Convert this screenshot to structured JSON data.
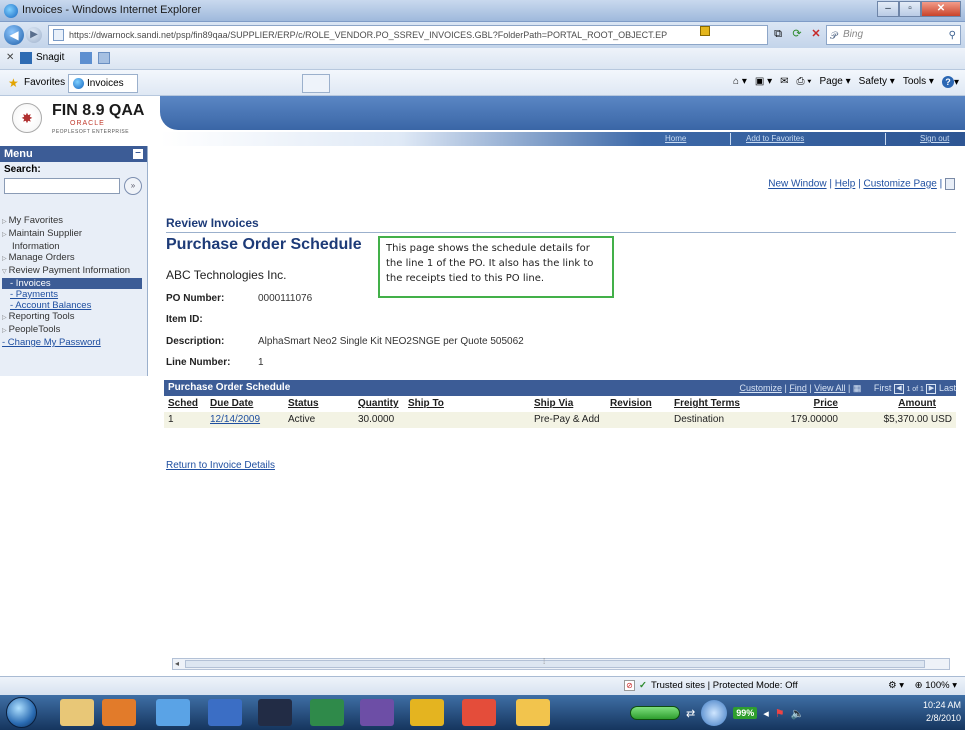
{
  "window": {
    "title": "Invoices - Windows Internet Explorer",
    "url": "https://dwarnock.sandi.net/psp/fin89qaa/SUPPLIER/ERP/c/ROLE_VENDOR.PO_SSREV_INVOICES.GBL?FolderPath=PORTAL_ROOT_OBJECT.EP",
    "url_host": "dwarnock.sandi.net",
    "search_placeholder": "Bing"
  },
  "toolbar": {
    "snagit_label": "Snagit"
  },
  "favorites": {
    "label": "Favorites",
    "tab_label": "Invoices",
    "commands": [
      "Page ▾",
      "Safety ▾",
      "Tools ▾"
    ]
  },
  "ps_header": {
    "title": "FIN 8.9 QAA",
    "oracle": "ORACLE",
    "sub": "PEOPLESOFT ENTERPRISE",
    "nav": [
      "Home",
      "Add to Favorites",
      "Sign out"
    ]
  },
  "menu": {
    "title": "Menu",
    "search_label": "Search:",
    "go_label": "»",
    "items": [
      {
        "label": "My Favorites"
      },
      {
        "label": "Maintain Supplier"
      },
      {
        "label": "Information"
      },
      {
        "label": "Manage Orders"
      },
      {
        "label": "Review Payment Information"
      },
      {
        "label": "- Invoices"
      },
      {
        "label": "- Payments"
      },
      {
        "label": "- Account Balances"
      },
      {
        "label": "Reporting Tools"
      },
      {
        "label": "PeopleTools"
      },
      {
        "label": "- Change My Password"
      }
    ]
  },
  "page_links": {
    "new_window": "New Window",
    "help": "Help",
    "customize": "Customize Page"
  },
  "page": {
    "section_title": "Review Invoices",
    "title": "Purchase Order Schedule",
    "vendor": "ABC Technologies Inc.",
    "callout": "This page shows the schedule details for the line 1 of the PO. It also has the link to the receipts tied to this PO line.",
    "fields": {
      "po_number_label": "PO Number:",
      "po_number": "0000111076",
      "item_id_label": "Item ID:",
      "description_label": "Description:",
      "description": "AlphaSmart Neo2 Single Kit NEO2SNGE per Quote 505062",
      "line_number_label": "Line Number:",
      "line_number": "1"
    },
    "return_link": "Return to Invoice Details"
  },
  "grid": {
    "title": "Purchase Order Schedule",
    "customize": "Customize",
    "find": "Find",
    "view_all": "View All",
    "first": "First",
    "range": "1 of 1",
    "last": "Last",
    "columns": {
      "sched": "Sched",
      "due_date": "Due Date",
      "status": "Status",
      "quantity": "Quantity",
      "ship_to": "Ship To",
      "ship_via": "Ship Via",
      "revision": "Revision",
      "freight_terms": "Freight Terms",
      "price": "Price",
      "amount": "Amount"
    },
    "rows": [
      {
        "sched": "1",
        "due_date": "12/14/2009",
        "status": "Active",
        "quantity": "30.0000",
        "ship_via": "Pre-Pay & Add",
        "freight_terms": "Destination",
        "price": "179.00000",
        "amount": "$5,370.00 USD"
      }
    ]
  },
  "status": {
    "zone": "Trusted sites | Protected Mode: Off",
    "zoom": "100%"
  },
  "taskbar": {
    "battery": "99%",
    "time": "10:24 AM",
    "date": "2/8/2010"
  }
}
